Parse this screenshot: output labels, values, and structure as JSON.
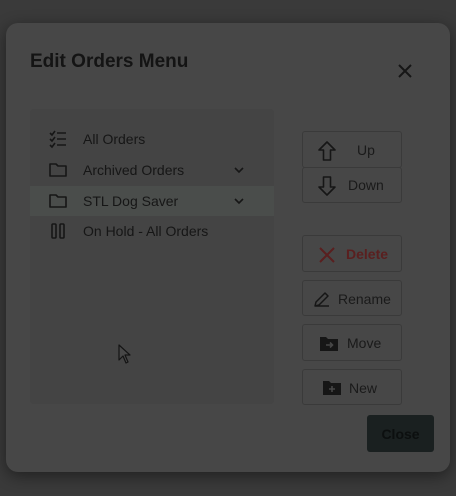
{
  "dialog": {
    "title": "Edit Orders Menu"
  },
  "menu_items": [
    {
      "label": "All Orders",
      "icon": "checklist-icon",
      "expandable": false,
      "selected": false
    },
    {
      "label": "Archived Orders",
      "icon": "folder-icon",
      "expandable": true,
      "selected": false
    },
    {
      "label": "STL Dog Saver",
      "icon": "folder-icon",
      "expandable": true,
      "selected": true
    },
    {
      "label": "On Hold - All Orders",
      "icon": "pause-icon",
      "expandable": false,
      "selected": false
    }
  ],
  "actions": {
    "up": "Up",
    "down": "Down",
    "delete": "Delete",
    "rename": "Rename",
    "move": "Move",
    "new": "New"
  },
  "footer": {
    "close": "Close"
  },
  "colors": {
    "delete_accent": "#5a1f1f",
    "close_button_bg": "#1a2020"
  }
}
